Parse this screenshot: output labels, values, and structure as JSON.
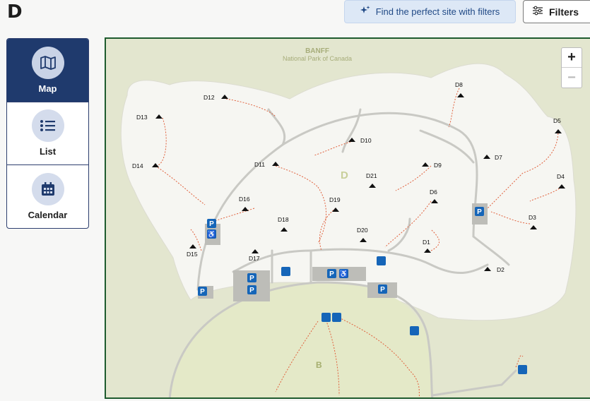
{
  "header": {
    "title": "D",
    "find_button_label": "Find the perfect site with filters",
    "filters_button_label": "Filters"
  },
  "view_nav": {
    "items": [
      {
        "label": "Map",
        "icon": "map-icon",
        "active": true
      },
      {
        "label": "List",
        "icon": "list-icon",
        "active": false
      },
      {
        "label": "Calendar",
        "icon": "calendar-icon",
        "active": false
      }
    ]
  },
  "map": {
    "park_name": "BANFF",
    "park_subtitle": "National Park of Canada",
    "loop_label": "D",
    "area_label": "B",
    "zoom_in": "+",
    "zoom_out": "−",
    "sites": [
      "D1",
      "D2",
      "D3",
      "D4",
      "D5",
      "D6",
      "D7",
      "D8",
      "D9",
      "D10",
      "D11",
      "D12",
      "D13",
      "D14",
      "D15",
      "D16",
      "D17",
      "D18",
      "D19",
      "D20",
      "D21"
    ]
  },
  "colors": {
    "accent": "#1f3a6d",
    "map_border": "#1e5b2e",
    "parking": "#1565b8",
    "trail": "#e0603c"
  }
}
